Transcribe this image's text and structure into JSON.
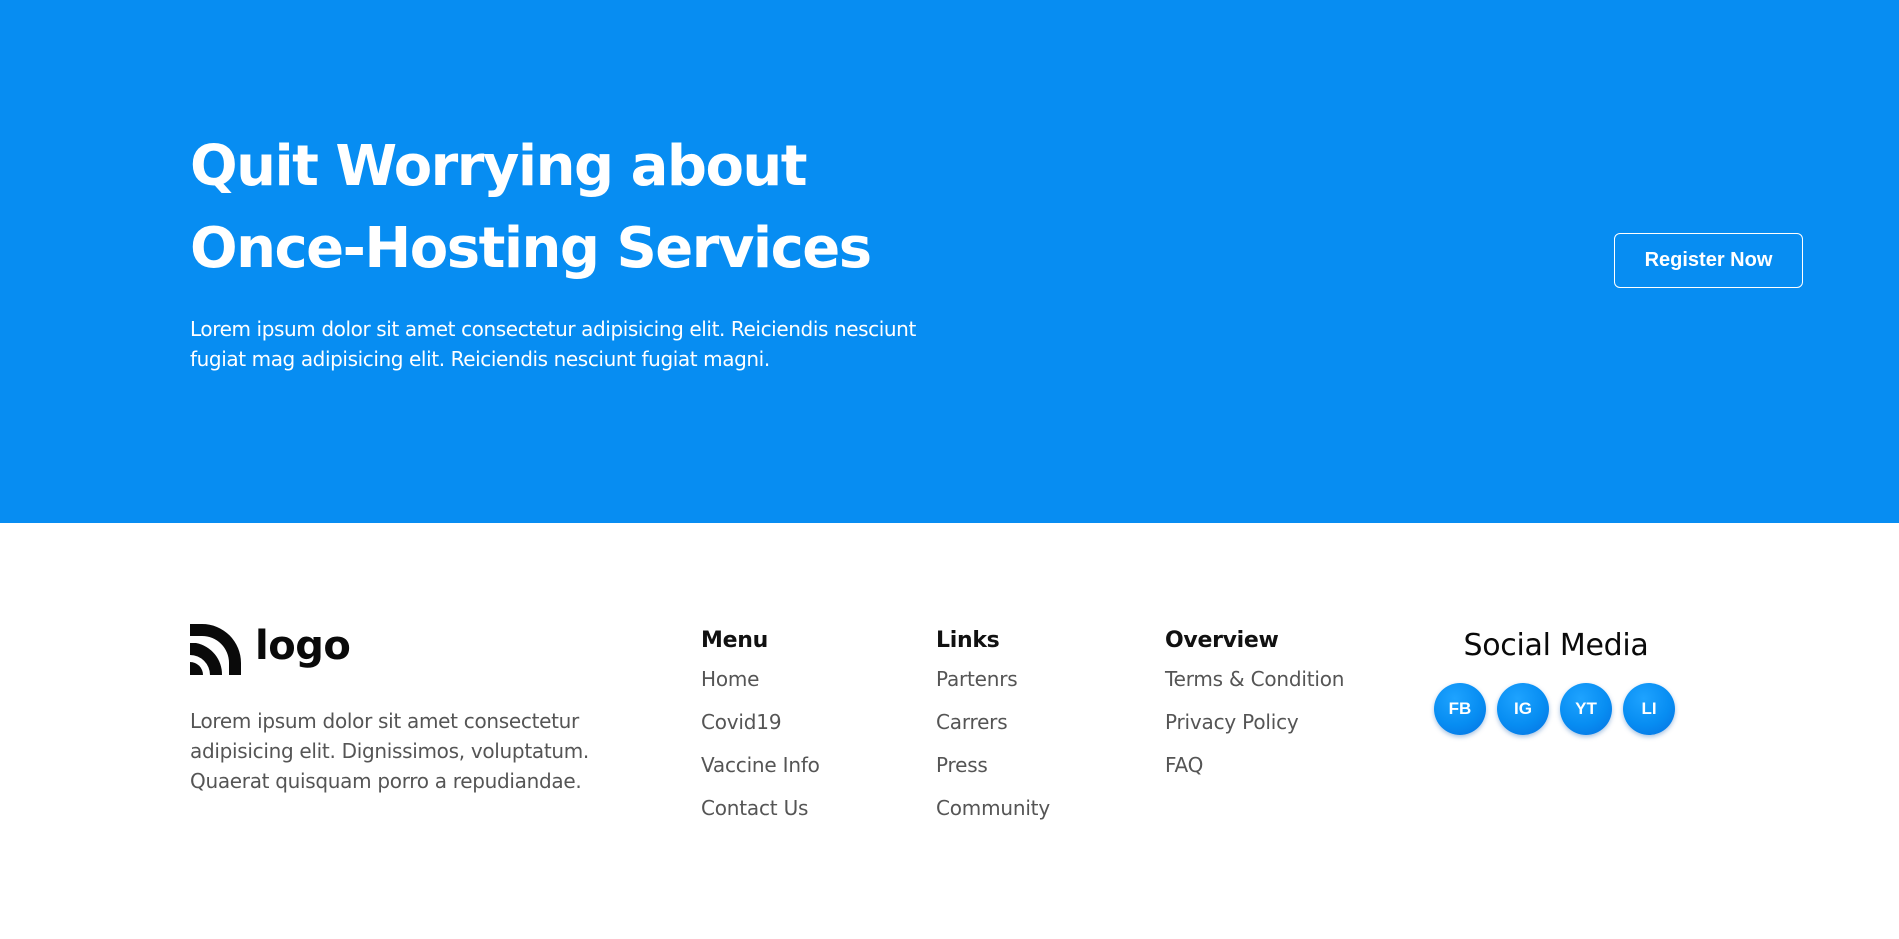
{
  "hero": {
    "title_line1": "Quit Worrying about",
    "title_line2": "Once-Hosting Services",
    "text_line1": "Lorem ipsum dolor sit amet consectetur adipisicing elit. Reiciendis nesciunt",
    "text_line2": "fugiat mag adipisicing elit. Reiciendis nesciunt fugiat magni.",
    "register_label": "Register Now"
  },
  "footer": {
    "logo_text": "logo",
    "about_line1": "Lorem ipsum dolor sit amet consectetur",
    "about_line2": "adipisicing elit. Dignissimos, voluptatum.",
    "about_line3": "Quaerat quisquam porro a repudiandae.",
    "menu": {
      "heading": "Menu",
      "items": [
        "Home",
        "Covid19",
        "Vaccine Info",
        "Contact Us"
      ]
    },
    "links": {
      "heading": "Links",
      "items": [
        "Partenrs",
        "Carrers",
        "Press",
        "Community"
      ]
    },
    "overview": {
      "heading": "Overview",
      "items": [
        "Terms & Condition",
        "Privacy Policy",
        "FAQ"
      ]
    },
    "social": {
      "heading": "Social Media",
      "icons": [
        "FB",
        "IG",
        "YT",
        "LI"
      ]
    }
  },
  "colors": {
    "accent": "#078df2",
    "heading_text": "#111111",
    "body_text": "#555555"
  }
}
